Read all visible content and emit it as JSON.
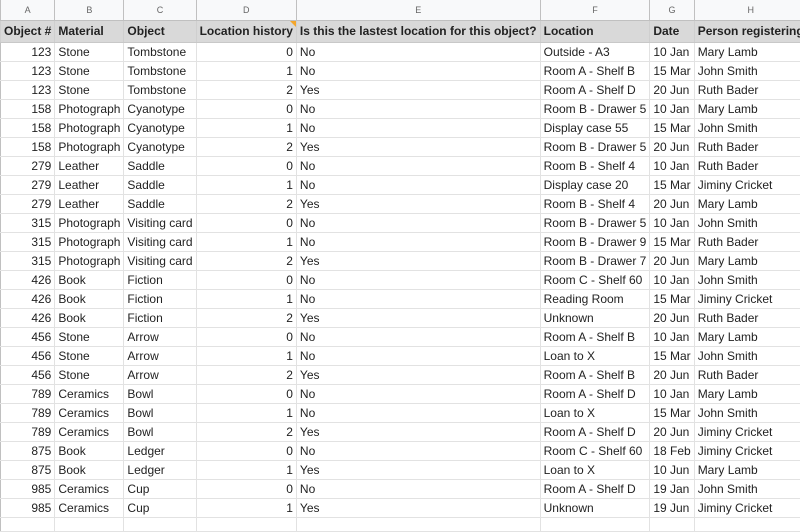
{
  "column_letters": [
    "A",
    "B",
    "C",
    "D",
    "E",
    "F",
    "G",
    "H"
  ],
  "headers": [
    "Object #",
    "Material",
    "Object",
    "Location history",
    "Is this the lastest location for this object?",
    "Location",
    "Date",
    "Person registering"
  ],
  "comment_indicator_color": "#f4a62a",
  "rows": [
    [
      "123",
      "Stone",
      "Tombstone",
      "0",
      "No",
      "Outside - A3",
      "10 Jan",
      "Mary Lamb"
    ],
    [
      "123",
      "Stone",
      "Tombstone",
      "1",
      "No",
      "Room A - Shelf B",
      "15 Mar",
      "John Smith"
    ],
    [
      "123",
      "Stone",
      "Tombstone",
      "2",
      "Yes",
      "Room A - Shelf D",
      "20 Jun",
      "Ruth Bader"
    ],
    [
      "158",
      "Photograph",
      "Cyanotype",
      "0",
      "No",
      "Room B - Drawer 5",
      "10 Jan",
      "Mary Lamb"
    ],
    [
      "158",
      "Photograph",
      "Cyanotype",
      "1",
      "No",
      "Display case 55",
      "15 Mar",
      "John Smith"
    ],
    [
      "158",
      "Photograph",
      "Cyanotype",
      "2",
      "Yes",
      "Room B - Drawer 5",
      "20 Jun",
      "Ruth Bader"
    ],
    [
      "279",
      "Leather",
      "Saddle",
      "0",
      "No",
      "Room B - Shelf 4",
      "10 Jan",
      "Ruth Bader"
    ],
    [
      "279",
      "Leather",
      "Saddle",
      "1",
      "No",
      "Display case 20",
      "15 Mar",
      "Jiminy Cricket"
    ],
    [
      "279",
      "Leather",
      "Saddle",
      "2",
      "Yes",
      "Room B - Shelf 4",
      "20 Jun",
      "Mary Lamb"
    ],
    [
      "315",
      "Photograph",
      "Visiting card",
      "0",
      "No",
      "Room B - Drawer 5",
      "10 Jan",
      "John Smith"
    ],
    [
      "315",
      "Photograph",
      "Visiting card",
      "1",
      "No",
      "Room B - Drawer 9",
      "15 Mar",
      "Ruth Bader"
    ],
    [
      "315",
      "Photograph",
      "Visiting card",
      "2",
      "Yes",
      "Room B - Drawer 7",
      "20 Jun",
      "Mary Lamb"
    ],
    [
      "426",
      "Book",
      "Fiction",
      "0",
      "No",
      "Room C - Shelf 60",
      "10 Jan",
      "John Smith"
    ],
    [
      "426",
      "Book",
      "Fiction",
      "1",
      "No",
      "Reading Room",
      "15 Mar",
      "Jiminy Cricket"
    ],
    [
      "426",
      "Book",
      "Fiction",
      "2",
      "Yes",
      "Unknown",
      "20 Jun",
      "Ruth Bader"
    ],
    [
      "456",
      "Stone",
      "Arrow",
      "0",
      "No",
      "Room A - Shelf B",
      "10 Jan",
      "Mary Lamb"
    ],
    [
      "456",
      "Stone",
      "Arrow",
      "1",
      "No",
      "Loan to X",
      "15 Mar",
      "John Smith"
    ],
    [
      "456",
      "Stone",
      "Arrow",
      "2",
      "Yes",
      "Room A - Shelf B",
      "20 Jun",
      "Ruth Bader"
    ],
    [
      "789",
      "Ceramics",
      "Bowl",
      "0",
      "No",
      "Room A - Shelf D",
      "10 Jan",
      "Mary Lamb"
    ],
    [
      "789",
      "Ceramics",
      "Bowl",
      "1",
      "No",
      "Loan to X",
      "15 Mar",
      "John Smith"
    ],
    [
      "789",
      "Ceramics",
      "Bowl",
      "2",
      "Yes",
      "Room A - Shelf D",
      "20 Jun",
      "Jiminy Cricket"
    ],
    [
      "875",
      "Book",
      "Ledger",
      "0",
      "No",
      "Room C - Shelf 60",
      "18 Feb",
      "Jiminy Cricket"
    ],
    [
      "875",
      "Book",
      "Ledger",
      "1",
      "Yes",
      "Loan to X",
      "10 Jun",
      "Mary Lamb"
    ],
    [
      "985",
      "Ceramics",
      "Cup",
      "0",
      "No",
      "Room A - Shelf D",
      "19 Jan",
      "John Smith"
    ],
    [
      "985",
      "Ceramics",
      "Cup",
      "1",
      "Yes",
      "Unknown",
      "19 Jun",
      "Jiminy Cricket"
    ]
  ]
}
